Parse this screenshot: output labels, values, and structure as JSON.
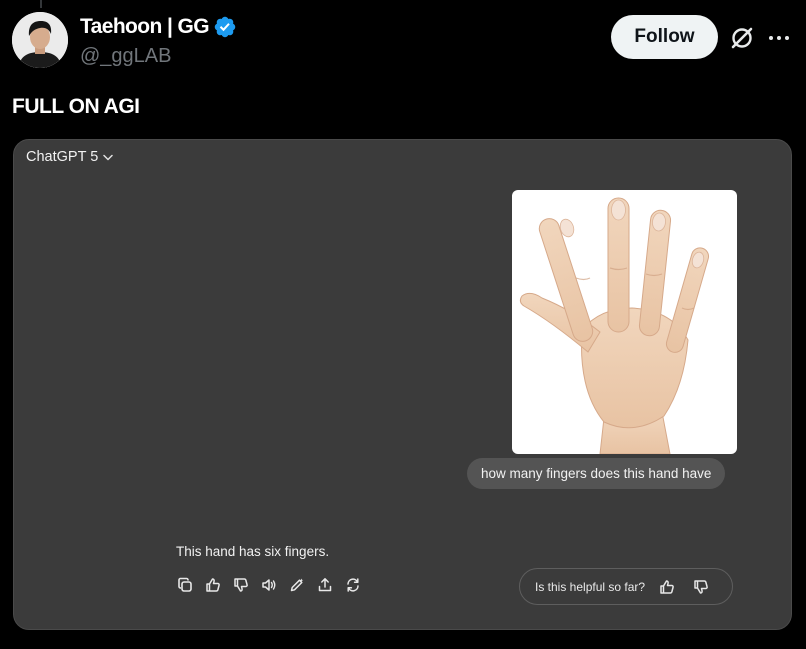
{
  "tweet": {
    "author_name": "Taehoon | GG",
    "author_handle": "@_ggLAB",
    "follow_label": "Follow",
    "text": "FULL ON AGI"
  },
  "chat": {
    "model_label": "ChatGPT 5",
    "user_message": "how many fingers does this hand have",
    "assistant_message": "This hand has six fingers.",
    "feedback_prompt": "Is this helpful so far?"
  },
  "colors": {
    "background": "#000000",
    "card": "#3b3b3b",
    "bubble": "#545454",
    "verified": "#1d9bf0",
    "follow_bg": "#eff3f4"
  },
  "icons": {
    "verified": "verified-badge-icon",
    "grok": "grok-icon",
    "more": "more-icon",
    "model_chevron": "chevron-down-icon",
    "actions": [
      "copy-icon",
      "thumbs-up-icon",
      "thumbs-down-icon",
      "read-aloud-icon",
      "edit-icon",
      "share-icon",
      "regenerate-icon"
    ],
    "feedback": [
      "thumbs-up-icon",
      "thumbs-down-icon"
    ]
  }
}
